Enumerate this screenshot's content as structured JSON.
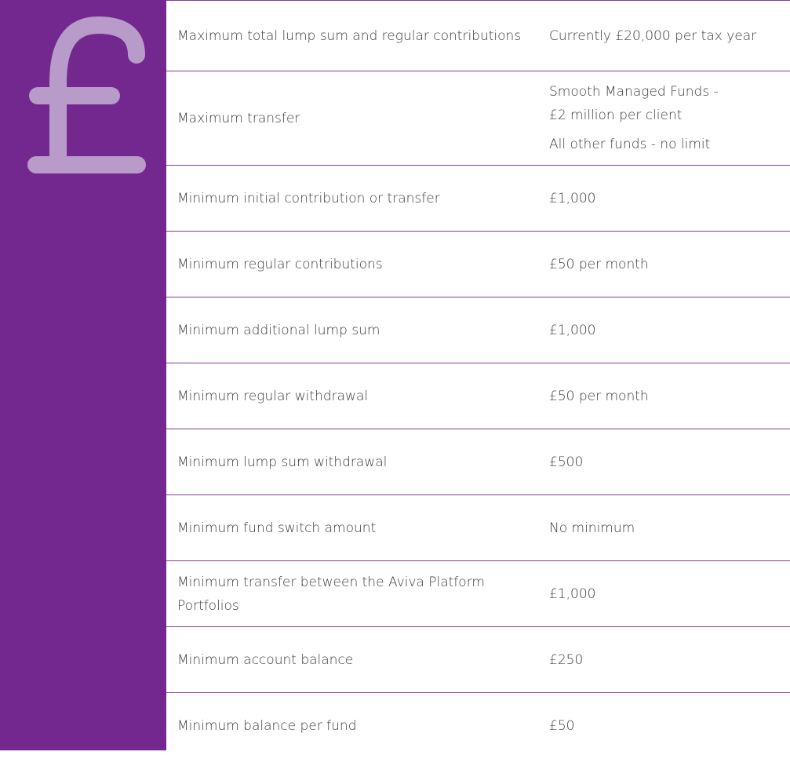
{
  "colors": {
    "panel": "#73288f",
    "pound_icon": "#b89bc8",
    "rule": "#7f3f98",
    "text": "#3c3c3c"
  },
  "side_panel": {
    "icon": "pound-sign-icon"
  },
  "rows": [
    {
      "label": "Maximum total lump sum and regular contributions",
      "values": [
        "Currently £20,000 per tax year"
      ]
    },
    {
      "label": "Maximum transfer",
      "values": [
        "Smooth Managed Funds -",
        "£2 million per client",
        "All other funds - no limit"
      ]
    },
    {
      "label": "Minimum initial contribution or transfer",
      "values": [
        "£1,000"
      ]
    },
    {
      "label": "Minimum regular contributions",
      "values": [
        "£50 per month"
      ]
    },
    {
      "label": "Minimum additional lump sum",
      "values": [
        "£1,000"
      ]
    },
    {
      "label": "Minimum regular withdrawal",
      "values": [
        "£50 per month"
      ]
    },
    {
      "label": "Minimum lump sum withdrawal",
      "values": [
        "£500"
      ]
    },
    {
      "label": "Minimum fund switch amount",
      "values": [
        "No minimum"
      ]
    },
    {
      "label": "Minimum transfer between the Aviva Platform Portfolios",
      "values": [
        "£1,000"
      ]
    },
    {
      "label": "Minimum account balance",
      "values": [
        "£250"
      ]
    },
    {
      "label": "Minimum balance per fund",
      "values": [
        "£50"
      ]
    }
  ]
}
